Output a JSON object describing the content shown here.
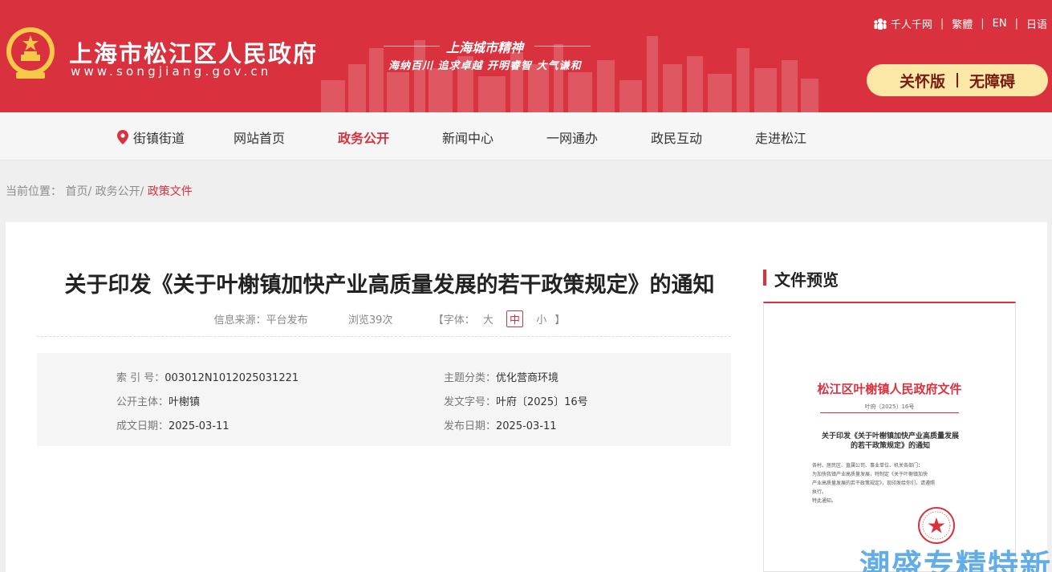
{
  "header": {
    "site_name": "上海市松江区人民政府",
    "site_url": "www.songjiang.gov.cn",
    "spirit_title": "上海城市精神",
    "spirit_text": "海纳百川  追求卓越  开明睿智  大气谦和",
    "toplinks": {
      "thousand": "千人千网",
      "traditional": "繁體",
      "english": "EN",
      "japanese": "日语"
    },
    "care_version": "关怀版",
    "accessibility": "无障碍"
  },
  "nav": {
    "town_street": "街镇街道",
    "items": [
      "网站首页",
      "政务公开",
      "新闻中心",
      "一网通办",
      "政民互动",
      "走进松江"
    ],
    "active_index": 1
  },
  "breadcrumb": {
    "prefix": "当前位置：",
    "home": "首页",
    "section": "政务公开",
    "current": "政策文件",
    "sep": "/ "
  },
  "article": {
    "title": "关于印发《关于叶榭镇加快产业高质量发展的若干政策规定》的通知",
    "source": "信息来源：平台发布",
    "views": "浏览39次",
    "font_label": "【字体：",
    "font_close": "】",
    "font_sizes": [
      "大",
      "中",
      "小"
    ],
    "font_active": 1
  },
  "info": {
    "index_label": "索 引 号：",
    "index_value": "003012N1012025031221",
    "topic_label": "主题分类：",
    "topic_value": "优化营商环境",
    "publisher_label": "公开主体：",
    "publisher_value": "叶榭镇",
    "docno_label": "发文字号：",
    "docno_value": "叶府〔2025〕16号",
    "created_label": "成文日期：",
    "created_value": "2025-03-11",
    "published_label": "发布日期：",
    "published_value": "2025-03-11"
  },
  "preview": {
    "heading": "文件预览",
    "doc_org": "松江区叶榭镇人民政府文件",
    "doc_no": "叶府〔2025〕16号",
    "doc_heading_1": "关于印发《关于叶榭镇加快产业高质量发展",
    "doc_heading_2": "的若干政策规定》的通知",
    "doc_body": [
      "各村、居民区、直属公司、事业单位、机关各部门：",
      "    为加快我镇产业高质量发展，特制定《关于叶榭镇加快",
      "产业高质量发展的若干政策规定》，现印发给你们，请遵照",
      "执行。",
      "    特此通知。"
    ]
  },
  "watermark": "潮盛专精特新",
  "colors": {
    "brand_red": "#d9323e",
    "pill_yellow": "#fbe7a6"
  }
}
